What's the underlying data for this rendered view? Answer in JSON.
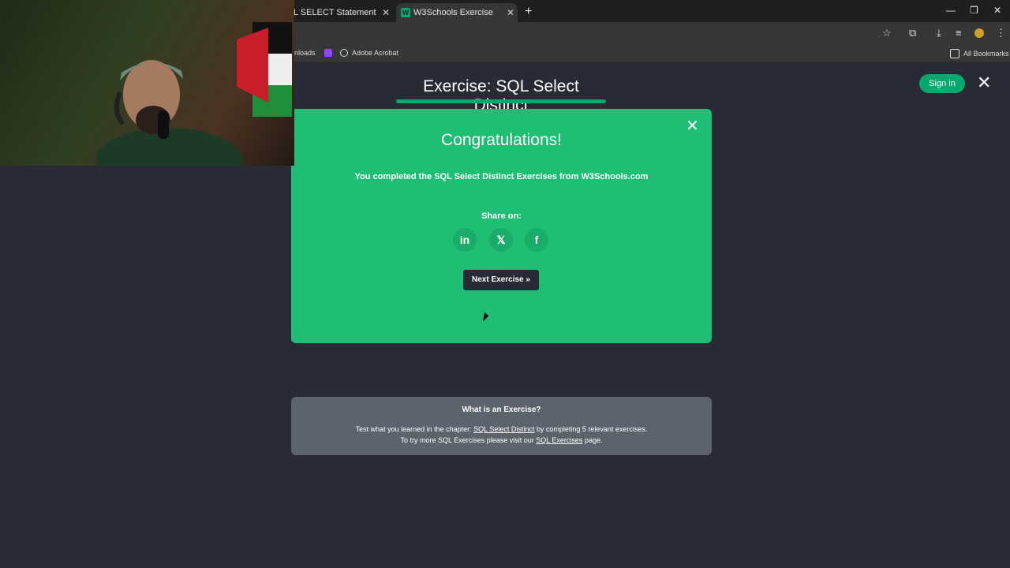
{
  "browser": {
    "tabs": [
      {
        "title": "L SELECT Statement",
        "active": false
      },
      {
        "title": "W3Schools Exercise",
        "active": true
      }
    ],
    "new_tab": "+",
    "bookmarks": [
      {
        "label": "nloads"
      },
      {
        "label": "Adobe Acrobat"
      }
    ],
    "all_bookmarks": "All Bookmarks"
  },
  "page": {
    "title": "Exercise: SQL Select Distinct",
    "sign_in": "Sign in",
    "close": "✕"
  },
  "modal": {
    "heading": "Congratulations!",
    "message": "You completed the SQL Select Distinct Exercises from W3Schools.com",
    "share_label": "Share on:",
    "share": [
      {
        "name": "linkedin",
        "glyph": "in"
      },
      {
        "name": "x",
        "glyph": "𝕏"
      },
      {
        "name": "facebook",
        "glyph": "f"
      }
    ],
    "next_button": "Next Exercise »",
    "close": "✕"
  },
  "info_box": {
    "title": "What is an Exercise?",
    "line1_prefix": "Test what you learned in the chapter: ",
    "line1_link": "SQL Select Distinct",
    "line1_suffix": " by completing 5 relevant exercises.",
    "line2_prefix": "To try more SQL Exercises please visit our ",
    "line2_link": "SQL Exercises",
    "line2_suffix": " page."
  },
  "colors": {
    "accent": "#04aa6d",
    "modal_bg": "#1ebf74",
    "page_bg": "#282a35",
    "info_bg": "#5c636c"
  }
}
